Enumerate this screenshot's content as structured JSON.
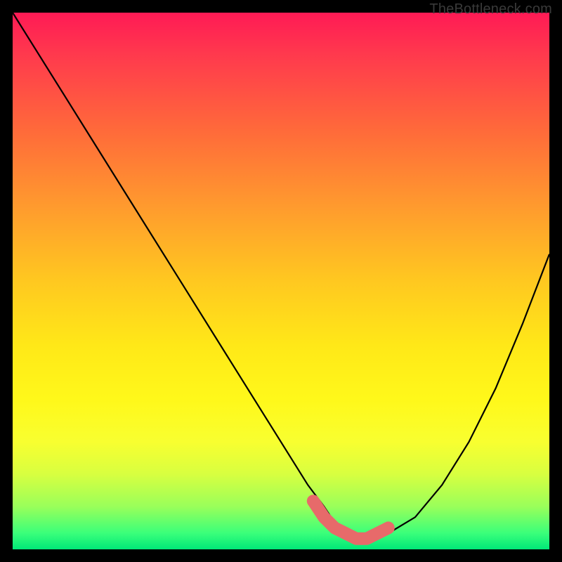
{
  "attribution": "TheBottleneck.com",
  "chart_data": {
    "type": "line",
    "title": "",
    "xlabel": "",
    "ylabel": "",
    "xlim": [
      0,
      100
    ],
    "ylim": [
      0,
      100
    ],
    "series": [
      {
        "name": "bottleneck-curve",
        "x": [
          0,
          10,
          20,
          30,
          40,
          50,
          55,
          58,
          60,
          62,
          64,
          66,
          68,
          70,
          75,
          80,
          85,
          90,
          95,
          100
        ],
        "values": [
          100,
          84,
          68,
          52,
          36,
          20,
          12,
          8,
          5,
          3,
          2,
          2,
          2,
          3,
          6,
          12,
          20,
          30,
          42,
          55
        ]
      }
    ],
    "highlight": {
      "name": "optimal-band",
      "x": [
        56,
        58,
        60,
        62,
        64,
        66,
        68,
        70
      ],
      "values": [
        9,
        6,
        4,
        3,
        2,
        2,
        3,
        4
      ]
    },
    "background_gradient": {
      "stops": [
        {
          "pos": 0.0,
          "color": "#ff1a55"
        },
        {
          "pos": 0.5,
          "color": "#ffc820"
        },
        {
          "pos": 0.8,
          "color": "#f8ff30"
        },
        {
          "pos": 1.0,
          "color": "#00e878"
        }
      ]
    }
  }
}
